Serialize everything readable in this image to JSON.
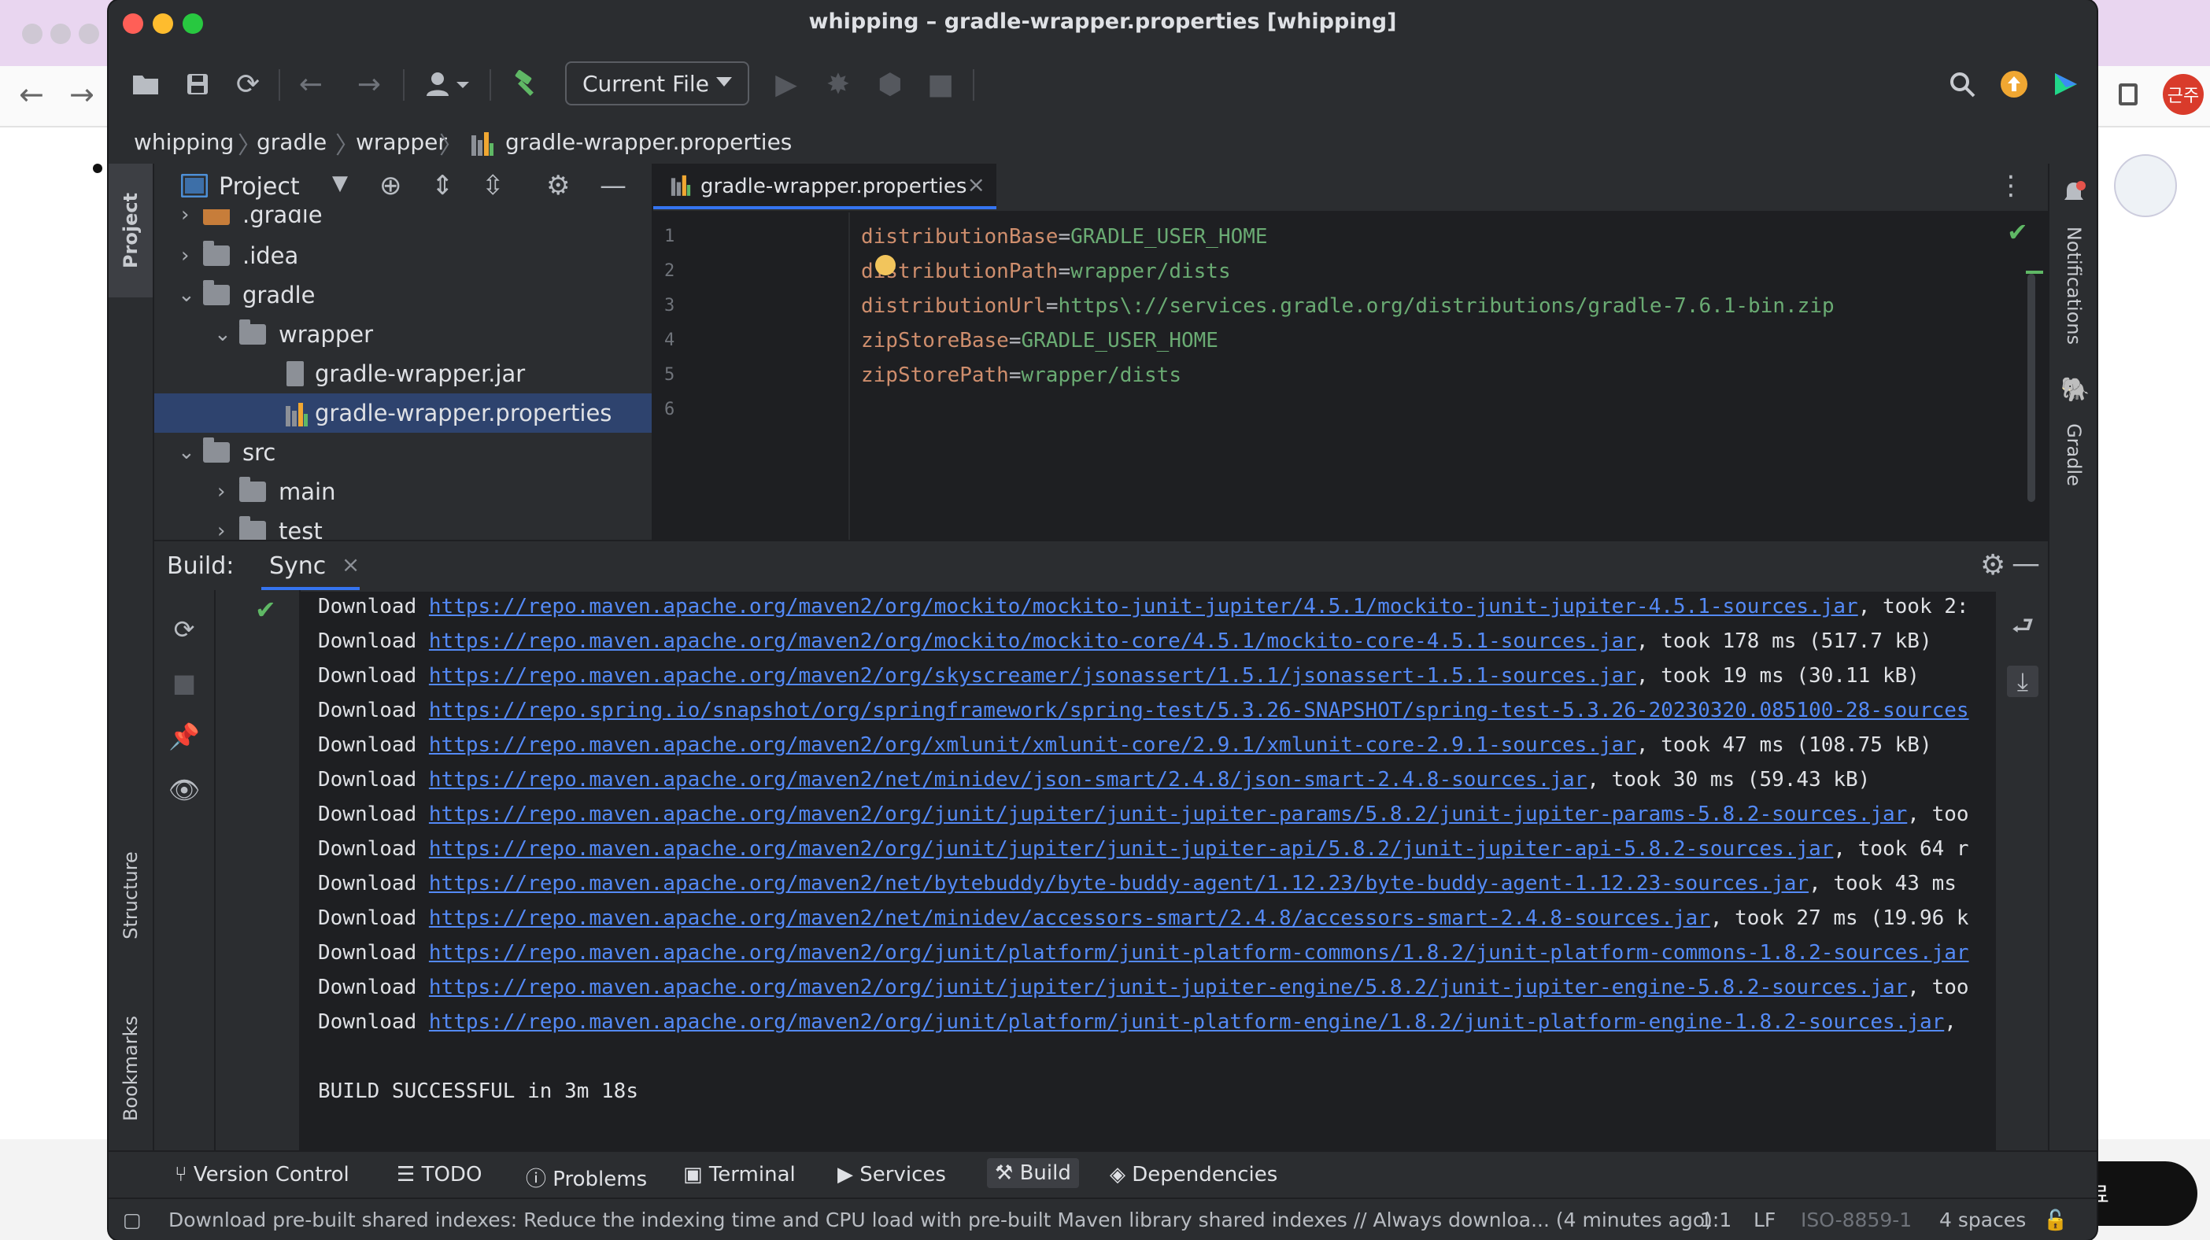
{
  "browser": {
    "avatar_text": "근주",
    "button_text": "료"
  },
  "window": {
    "title": "whipping – gradle-wrapper.properties [whipping]"
  },
  "toolbar": {
    "run_config": "Current File"
  },
  "breadcrumb": [
    "whipping",
    "gradle",
    "wrapper",
    "gradle-wrapper.properties"
  ],
  "left_stripe": {
    "project": "Project",
    "structure": "Structure",
    "bookmarks": "Bookmarks"
  },
  "right_stripe": {
    "notifications": "Notifications",
    "gradle": "Gradle"
  },
  "project_panel": {
    "title": "Project",
    "tree": [
      {
        "label": ".gradle",
        "indent": 0,
        "expanded": false,
        "kind": "folder-orange"
      },
      {
        "label": ".idea",
        "indent": 0,
        "expanded": false,
        "kind": "folder"
      },
      {
        "label": "gradle",
        "indent": 0,
        "expanded": true,
        "kind": "folder"
      },
      {
        "label": "wrapper",
        "indent": 1,
        "expanded": true,
        "kind": "folder"
      },
      {
        "label": "gradle-wrapper.jar",
        "indent": 2,
        "kind": "jar"
      },
      {
        "label": "gradle-wrapper.properties",
        "indent": 2,
        "kind": "properties",
        "selected": true
      },
      {
        "label": "src",
        "indent": 0,
        "expanded": true,
        "kind": "folder"
      },
      {
        "label": "main",
        "indent": 1,
        "expanded": false,
        "kind": "folder"
      },
      {
        "label": "test",
        "indent": 1,
        "expanded": false,
        "kind": "folder"
      }
    ]
  },
  "editor": {
    "tab_label": "gradle-wrapper.properties",
    "line_numbers": [
      "1",
      "2",
      "3",
      "4",
      "5",
      "6"
    ],
    "lines": [
      {
        "key": "distributionBase",
        "value": "GRADLE_USER_HOME"
      },
      {
        "key": "distributionPath",
        "value": "wrapper/dists"
      },
      {
        "key": "distributionUrl",
        "value": "https\\://services.gradle.org/distributions/gradle-7.6.1-bin.zip"
      },
      {
        "key": "zipStoreBase",
        "value": "GRADLE_USER_HOME"
      },
      {
        "key": "zipStorePath",
        "value": "wrapper/dists"
      },
      {
        "key": "",
        "value": ""
      }
    ]
  },
  "build": {
    "label": "Build:",
    "tab": "Sync",
    "console": [
      {
        "prefix": "Download ",
        "url": "https://repo.maven.apache.org/maven2/org/mockito/mockito-junit-jupiter/4.5.1/mockito-junit-jupiter-4.5.1-sources.jar",
        "suffix": ", took 2:"
      },
      {
        "prefix": "Download ",
        "url": "https://repo.maven.apache.org/maven2/org/mockito/mockito-core/4.5.1/mockito-core-4.5.1-sources.jar",
        "suffix": ", took 178 ms (517.7 kB)"
      },
      {
        "prefix": "Download ",
        "url": "https://repo.maven.apache.org/maven2/org/skyscreamer/jsonassert/1.5.1/jsonassert-1.5.1-sources.jar",
        "suffix": ", took 19 ms (30.11 kB)"
      },
      {
        "prefix": "Download ",
        "url": "https://repo.spring.io/snapshot/org/springframework/spring-test/5.3.26-SNAPSHOT/spring-test-5.3.26-20230320.085100-28-sources",
        "suffix": ""
      },
      {
        "prefix": "Download ",
        "url": "https://repo.maven.apache.org/maven2/org/xmlunit/xmlunit-core/2.9.1/xmlunit-core-2.9.1-sources.jar",
        "suffix": ", took 47 ms (108.75 kB)"
      },
      {
        "prefix": "Download ",
        "url": "https://repo.maven.apache.org/maven2/net/minidev/json-smart/2.4.8/json-smart-2.4.8-sources.jar",
        "suffix": ", took 30 ms (59.43 kB)"
      },
      {
        "prefix": "Download ",
        "url": "https://repo.maven.apache.org/maven2/org/junit/jupiter/junit-jupiter-params/5.8.2/junit-jupiter-params-5.8.2-sources.jar",
        "suffix": ", too"
      },
      {
        "prefix": "Download ",
        "url": "https://repo.maven.apache.org/maven2/org/junit/jupiter/junit-jupiter-api/5.8.2/junit-jupiter-api-5.8.2-sources.jar",
        "suffix": ", took 64 r"
      },
      {
        "prefix": "Download ",
        "url": "https://repo.maven.apache.org/maven2/net/bytebuddy/byte-buddy-agent/1.12.23/byte-buddy-agent-1.12.23-sources.jar",
        "suffix": ", took 43 ms"
      },
      {
        "prefix": "Download ",
        "url": "https://repo.maven.apache.org/maven2/net/minidev/accessors-smart/2.4.8/accessors-smart-2.4.8-sources.jar",
        "suffix": ", took 27 ms (19.96 k"
      },
      {
        "prefix": "Download ",
        "url": "https://repo.maven.apache.org/maven2/org/junit/platform/junit-platform-commons/1.8.2/junit-platform-commons-1.8.2-sources.jar",
        "suffix": ""
      },
      {
        "prefix": "Download ",
        "url": "https://repo.maven.apache.org/maven2/org/junit/jupiter/junit-jupiter-engine/5.8.2/junit-jupiter-engine-5.8.2-sources.jar",
        "suffix": ", too"
      },
      {
        "prefix": "Download ",
        "url": "https://repo.maven.apache.org/maven2/org/junit/platform/junit-platform-engine/1.8.2/junit-platform-engine-1.8.2-sources.jar",
        "suffix": ","
      }
    ],
    "result": "BUILD SUCCESSFUL in 3m 18s"
  },
  "bottom_bar": {
    "version_control": "Version Control",
    "todo": "TODO",
    "problems": "Problems",
    "terminal": "Terminal",
    "services": "Services",
    "build": "Build",
    "dependencies": "Dependencies"
  },
  "status_bar": {
    "message": "Download pre-built shared indexes: Reduce the indexing time and CPU load with pre-built Maven library shared indexes // Always downloa... (4 minutes ago)",
    "position": "1:1",
    "line_sep": "LF",
    "encoding": "ISO-8859-1",
    "indent": "4 spaces"
  },
  "colors": {
    "accent": "#3574f0",
    "link": "#548af7",
    "key": "#cf8e6d",
    "value": "#6aab73",
    "success": "#5fb865"
  }
}
